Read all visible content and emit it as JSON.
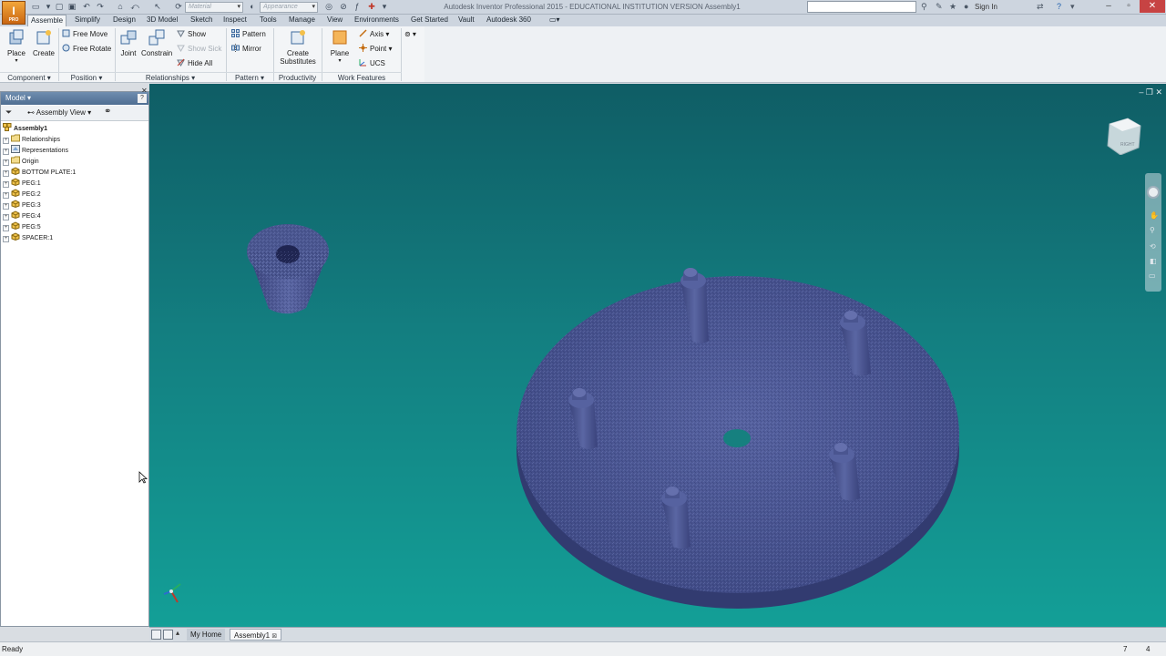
{
  "window": {
    "title": "Autodesk Inventor Professional 2015 - EDUCATIONAL INSTITUTION VERSION    Assembly1",
    "logo_text": "I",
    "logo_sub": "PRO",
    "sign_in": "Sign In"
  },
  "quick_access": {
    "material_placeholder": "Material",
    "appearance_placeholder": "Appearance"
  },
  "tabs": [
    "Assemble",
    "Simplify",
    "Design",
    "3D Model",
    "Sketch",
    "Inspect",
    "Tools",
    "Manage",
    "View",
    "Environments",
    "Get Started",
    "Vault",
    "Autodesk 360"
  ],
  "ribbon": {
    "component": {
      "place": "Place",
      "create": "Create",
      "title": "Component"
    },
    "position": {
      "free_move": "Free Move",
      "free_rotate": "Free Rotate",
      "title": "Position"
    },
    "relationships": {
      "joint": "Joint",
      "constrain": "Constrain",
      "show": "Show",
      "show_sick": "Show Sick",
      "hide_all": "Hide All",
      "title": "Relationships"
    },
    "pattern": {
      "pattern": "Pattern",
      "mirror": "Mirror",
      "title": "Pattern"
    },
    "productivity": {
      "create": "Create",
      "substitutes": "Substitutes",
      "title": "Productivity"
    },
    "work_features": {
      "plane": "Plane",
      "axis": "Axis",
      "point": "Point",
      "ucs": "UCS",
      "title": "Work Features"
    }
  },
  "browser": {
    "header": "Model",
    "view": "Assembly View",
    "tree": [
      {
        "label": "Assembly1",
        "icon": "assembly-icon",
        "root": true
      },
      {
        "label": "Relationships",
        "icon": "folder-icon"
      },
      {
        "label": "Representations",
        "icon": "representations-icon"
      },
      {
        "label": "Origin",
        "icon": "folder-icon"
      },
      {
        "label": "BOTTOM PLATE:1",
        "icon": "part-icon"
      },
      {
        "label": "PEG:1",
        "icon": "part-icon"
      },
      {
        "label": "PEG:2",
        "icon": "part-icon"
      },
      {
        "label": "PEG:3",
        "icon": "part-icon"
      },
      {
        "label": "PEG:4",
        "icon": "part-icon"
      },
      {
        "label": "PEG:5",
        "icon": "part-icon"
      },
      {
        "label": "SPACER:1",
        "icon": "part-icon"
      }
    ]
  },
  "viewcube": {
    "face": "RIGHT"
  },
  "doc_tabs": {
    "home": "My Home",
    "doc": "Assembly1"
  },
  "status": {
    "text": "Ready",
    "count_a": "7",
    "count_b": "4"
  },
  "colors": {
    "viewport_top": "#0f5d65",
    "viewport_bottom": "#139f97",
    "part": "#4a5590"
  }
}
